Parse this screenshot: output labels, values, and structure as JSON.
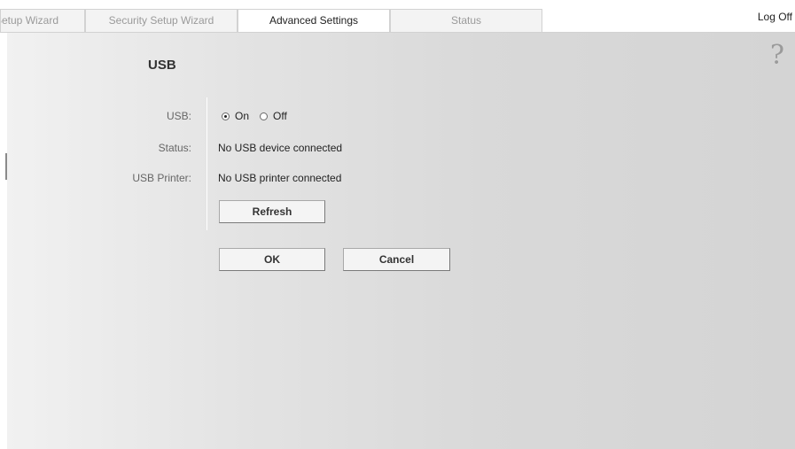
{
  "tabs": [
    {
      "label": "Setup Wizard",
      "active": false
    },
    {
      "label": "Security Setup Wizard",
      "active": false
    },
    {
      "label": "Advanced Settings",
      "active": true
    },
    {
      "label": "Status",
      "active": false
    }
  ],
  "header": {
    "logoff_label": "Log Off"
  },
  "panel": {
    "title": "USB",
    "help_icon": "?"
  },
  "form": {
    "usb_label": "USB:",
    "usb_options": [
      {
        "label": "On",
        "checked": true
      },
      {
        "label": "Off",
        "checked": false
      }
    ],
    "status_label": "Status:",
    "status_value": "No USB device connected",
    "printer_label": "USB Printer:",
    "printer_value": "No USB printer connected",
    "refresh_label": "Refresh",
    "ok_label": "OK",
    "cancel_label": "Cancel"
  },
  "icons": {
    "help": "question-mark-icon"
  }
}
